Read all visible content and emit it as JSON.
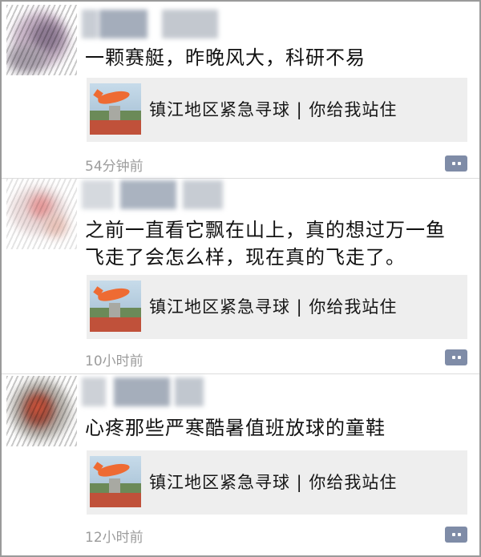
{
  "feed": {
    "posts": [
      {
        "text": "一颗赛艇，昨晚风大，科研不易",
        "share": {
          "title": "镇江地区紧急寻球 | 你给我站住"
        },
        "time": "54分钟前"
      },
      {
        "text": "之前一直看它飘在山上，真的想过万一鱼\n飞走了会怎么样，现在真的飞走了。",
        "share": {
          "title": "镇江地区紧急寻球 | 你给我站住"
        },
        "time": "10小时前"
      },
      {
        "text": "心疼那些严寒酷暑值班放球的童鞋",
        "share": {
          "title": "镇江地区紧急寻球 | 你给我站住"
        },
        "time": "12小时前"
      }
    ]
  },
  "icons": {
    "comment": "comment-bubble-icon",
    "balloon": "orange-balloon-thumbnail"
  },
  "colors": {
    "card_bg": "#eeeeee",
    "time_text": "#9c9c9c",
    "comment_button": "#7f8ca7"
  }
}
